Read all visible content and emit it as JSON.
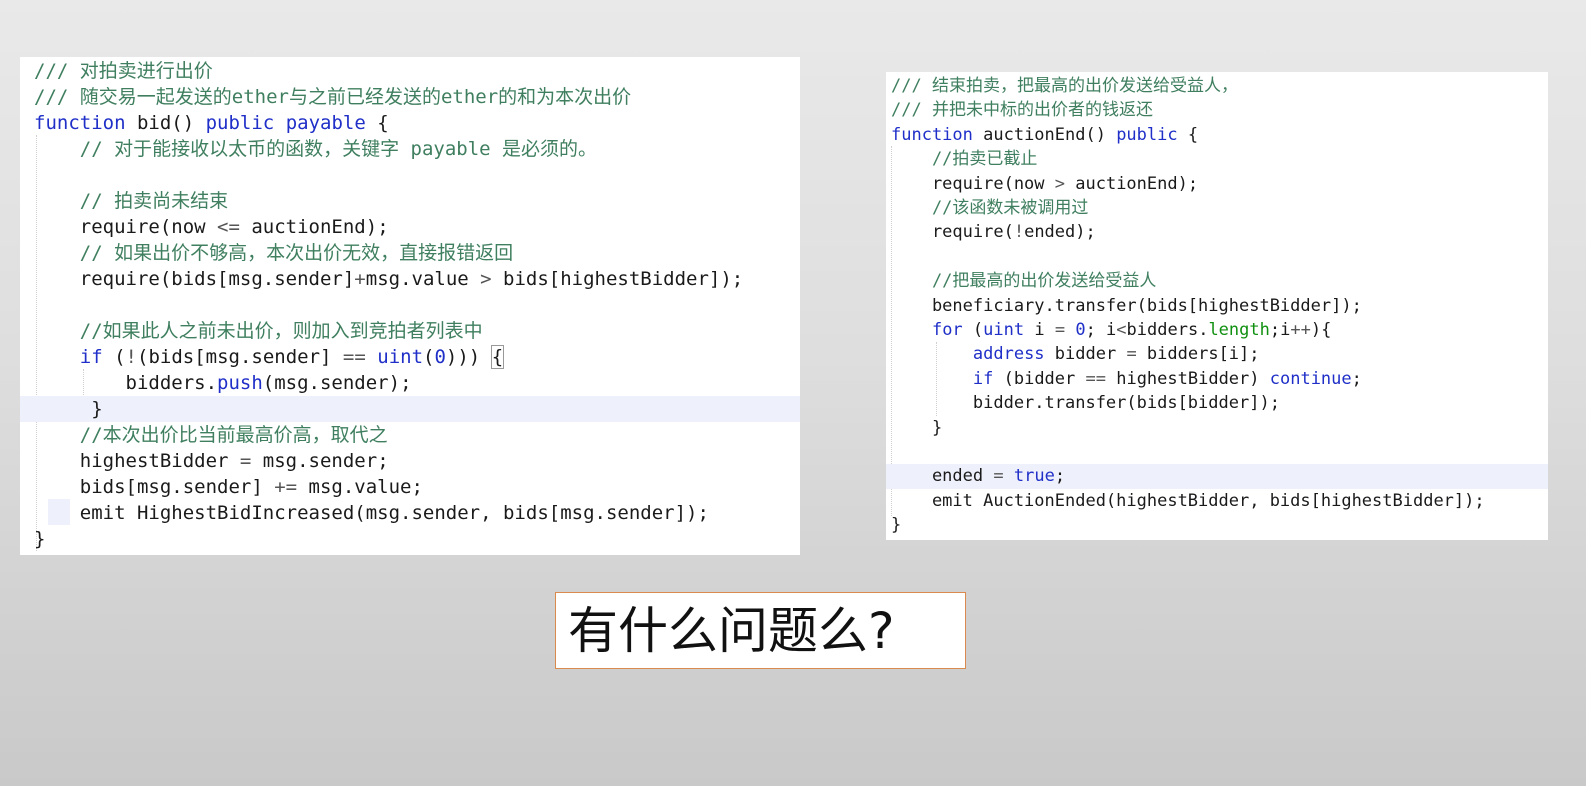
{
  "left_code": {
    "lines": [
      {
        "segments": [
          {
            "t": "/// 对拍卖进行出价",
            "c": "comment"
          }
        ]
      },
      {
        "segments": [
          {
            "t": "/// 随交易一起发送的ether与之前已经发送的ether的和为本次出价",
            "c": "comment"
          }
        ]
      },
      {
        "segments": [
          {
            "t": "function",
            "c": "kw"
          },
          {
            "t": " bid() ",
            "c": ""
          },
          {
            "t": "public",
            "c": "kw"
          },
          {
            "t": " ",
            "c": ""
          },
          {
            "t": "payable",
            "c": "kw"
          },
          {
            "t": " {",
            "c": ""
          }
        ]
      },
      {
        "segments": [
          {
            "t": "    // 对于能接收以太币的函数，关键字 payable 是必须的。",
            "c": "comment"
          }
        ]
      },
      {
        "segments": []
      },
      {
        "segments": [
          {
            "t": "    // 拍卖尚未结束",
            "c": "comment"
          }
        ]
      },
      {
        "segments": [
          {
            "t": "    require(now ",
            "c": ""
          },
          {
            "t": "<=",
            "c": "op"
          },
          {
            "t": " auctionEnd);",
            "c": ""
          }
        ]
      },
      {
        "segments": [
          {
            "t": "    // 如果出价不够高，本次出价无效，直接报错返回",
            "c": "comment"
          }
        ]
      },
      {
        "segments": [
          {
            "t": "    require(bids[msg.sender]",
            "c": ""
          },
          {
            "t": "+",
            "c": "op"
          },
          {
            "t": "msg.value ",
            "c": ""
          },
          {
            "t": ">",
            "c": "op"
          },
          {
            "t": " bids[highestBidder]);",
            "c": ""
          }
        ]
      },
      {
        "segments": []
      },
      {
        "segments": [
          {
            "t": "    //如果此人之前未出价，则加入到竞拍者列表中",
            "c": "comment"
          }
        ]
      },
      {
        "segments": [
          {
            "t": "    ",
            "c": ""
          },
          {
            "t": "if",
            "c": "kw"
          },
          {
            "t": " (",
            "c": ""
          },
          {
            "t": "!",
            "c": "op"
          },
          {
            "t": "(bids[msg.sender] ",
            "c": ""
          },
          {
            "t": "==",
            "c": "op"
          },
          {
            "t": " ",
            "c": ""
          },
          {
            "t": "uint",
            "c": "kw"
          },
          {
            "t": "(",
            "c": ""
          },
          {
            "t": "0",
            "c": "num"
          },
          {
            "t": "))) ",
            "c": ""
          },
          {
            "t": "{",
            "c": "box"
          }
        ]
      },
      {
        "segments": [
          {
            "t": "        bidders.",
            "c": ""
          },
          {
            "t": "push",
            "c": "kw"
          },
          {
            "t": "(msg.sender);",
            "c": ""
          }
        ]
      },
      {
        "segments": [
          {
            "t": "     }",
            "c": ""
          }
        ]
      },
      {
        "segments": [
          {
            "t": "    //本次出价比当前最高价高，取代之",
            "c": "comment"
          }
        ]
      },
      {
        "segments": [
          {
            "t": "    highestBidder ",
            "c": ""
          },
          {
            "t": "=",
            "c": "op"
          },
          {
            "t": " msg.sender;",
            "c": ""
          }
        ]
      },
      {
        "segments": [
          {
            "t": "    bids[msg.sender] ",
            "c": ""
          },
          {
            "t": "+=",
            "c": "op"
          },
          {
            "t": " msg.value;",
            "c": ""
          }
        ]
      },
      {
        "segments": [
          {
            "t": "    emit HighestBidIncreased(msg.sender, bids[msg.sender]);",
            "c": ""
          }
        ]
      },
      {
        "segments": [
          {
            "t": "}",
            "c": ""
          }
        ]
      }
    ]
  },
  "right_code": {
    "lines": [
      {
        "segments": [
          {
            "t": "/// 结束拍卖，把最高的出价发送给受益人，",
            "c": "comment"
          }
        ]
      },
      {
        "segments": [
          {
            "t": "/// 并把未中标的出价者的钱返还",
            "c": "comment"
          }
        ]
      },
      {
        "segments": [
          {
            "t": "function",
            "c": "kw"
          },
          {
            "t": " auctionEnd() ",
            "c": ""
          },
          {
            "t": "public",
            "c": "kw"
          },
          {
            "t": " {",
            "c": ""
          }
        ]
      },
      {
        "segments": [
          {
            "t": "    //拍卖已截止",
            "c": "comment"
          }
        ]
      },
      {
        "segments": [
          {
            "t": "    require(now ",
            "c": ""
          },
          {
            "t": ">",
            "c": "op"
          },
          {
            "t": " auctionEnd);",
            "c": ""
          }
        ]
      },
      {
        "segments": [
          {
            "t": "    //该函数未被调用过",
            "c": "comment"
          }
        ]
      },
      {
        "segments": [
          {
            "t": "    require(",
            "c": ""
          },
          {
            "t": "!",
            "c": "op"
          },
          {
            "t": "ended);",
            "c": ""
          }
        ]
      },
      {
        "segments": []
      },
      {
        "segments": [
          {
            "t": "    //把最高的出价发送给受益人",
            "c": "comment"
          }
        ]
      },
      {
        "segments": [
          {
            "t": "    beneficiary.transfer(bids[highestBidder]);",
            "c": ""
          }
        ]
      },
      {
        "segments": [
          {
            "t": "    ",
            "c": ""
          },
          {
            "t": "for",
            "c": "kw"
          },
          {
            "t": " (",
            "c": ""
          },
          {
            "t": "uint",
            "c": "kw"
          },
          {
            "t": " i ",
            "c": ""
          },
          {
            "t": "=",
            "c": "op"
          },
          {
            "t": " ",
            "c": ""
          },
          {
            "t": "0",
            "c": "num"
          },
          {
            "t": "; i",
            "c": ""
          },
          {
            "t": "<",
            "c": "op"
          },
          {
            "t": "bidders.",
            "c": ""
          },
          {
            "t": "length",
            "c": "green"
          },
          {
            "t": ";i",
            "c": ""
          },
          {
            "t": "++",
            "c": "op"
          },
          {
            "t": "){",
            "c": ""
          }
        ]
      },
      {
        "segments": [
          {
            "t": "        ",
            "c": ""
          },
          {
            "t": "address",
            "c": "kw"
          },
          {
            "t": " bidder ",
            "c": ""
          },
          {
            "t": "=",
            "c": "op"
          },
          {
            "t": " bidders[i];",
            "c": ""
          }
        ]
      },
      {
        "segments": [
          {
            "t": "        ",
            "c": ""
          },
          {
            "t": "if",
            "c": "kw"
          },
          {
            "t": " (bidder ",
            "c": ""
          },
          {
            "t": "==",
            "c": "op"
          },
          {
            "t": " highestBidder) ",
            "c": ""
          },
          {
            "t": "continue",
            "c": "kw"
          },
          {
            "t": ";",
            "c": ""
          }
        ]
      },
      {
        "segments": [
          {
            "t": "        bidder.transfer(bids[bidder]);",
            "c": ""
          }
        ]
      },
      {
        "segments": [
          {
            "t": "    }",
            "c": ""
          }
        ]
      },
      {
        "segments": []
      },
      {
        "segments": [
          {
            "t": "    ended ",
            "c": ""
          },
          {
            "t": "=",
            "c": "op"
          },
          {
            "t": " ",
            "c": ""
          },
          {
            "t": "true",
            "c": "kw"
          },
          {
            "t": ";",
            "c": ""
          }
        ]
      },
      {
        "segments": [
          {
            "t": "    emit AuctionEnded(highestBidder, bids[highestBidder]);",
            "c": ""
          }
        ]
      },
      {
        "segments": [
          {
            "t": "}",
            "c": ""
          }
        ]
      }
    ]
  },
  "caption": {
    "text": "有什么问题么?"
  }
}
